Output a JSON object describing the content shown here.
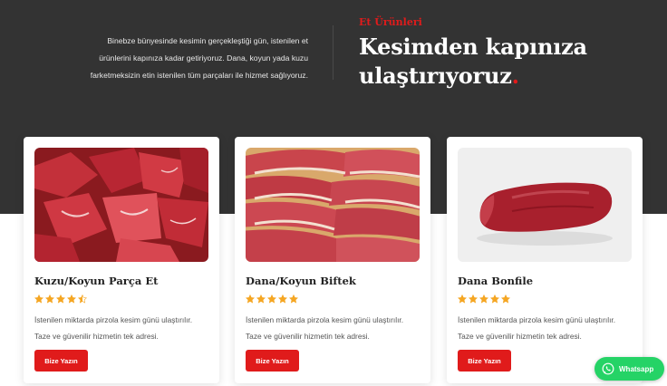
{
  "hero": {
    "description_lines": [
      "Binebze bünyesinde kesimin gerçekleştiği gün, istenilen et",
      "ürünlerini kapınıza kadar getiriyoruz. Dana, koyun yada kuzu",
      "farketmeksizin etin istenilen tüm parçaları ile hizmet sağlıyoruz."
    ],
    "eyebrow": "Et Ürünleri",
    "headline_line1": "Kesimden kapınıza",
    "headline_line2": "ulaştırıyoruz",
    "headline_dot": ".",
    "accent_color": "#e01b1b",
    "background_color": "#333333"
  },
  "products": [
    {
      "image_icon": "meat-chunks-image",
      "title": "Kuzu/Koyun Parça Et",
      "rating": 4.5,
      "desc_line1": "İstenilen miktarda pirzola kesim günü ulaştırılır.",
      "desc_line2": "Taze ve güvenilir hizmetin tek adresi.",
      "button_label": "Bize Yazın"
    },
    {
      "image_icon": "steak-slices-image",
      "title": "Dana/Koyun Biftek",
      "rating": 5,
      "desc_line1": "İstenilen miktarda pirzola kesim günü ulaştırılır.",
      "desc_line2": "Taze ve güvenilir hizmetin tek adresi.",
      "button_label": "Bize Yazın"
    },
    {
      "image_icon": "tenderloin-image",
      "title": "Dana Bonfile",
      "rating": 5,
      "desc_line1": "İstenilen miktarda pirzola kesim günü ulaştırılır.",
      "desc_line2": "Taze ve güvenilir hizmetin tek adresi.",
      "button_label": "Bize Yazın"
    }
  ],
  "star_color": "#f5a623",
  "whatsapp": {
    "label": "Whatsapp",
    "icon": "whatsapp-icon",
    "color": "#25d366"
  }
}
